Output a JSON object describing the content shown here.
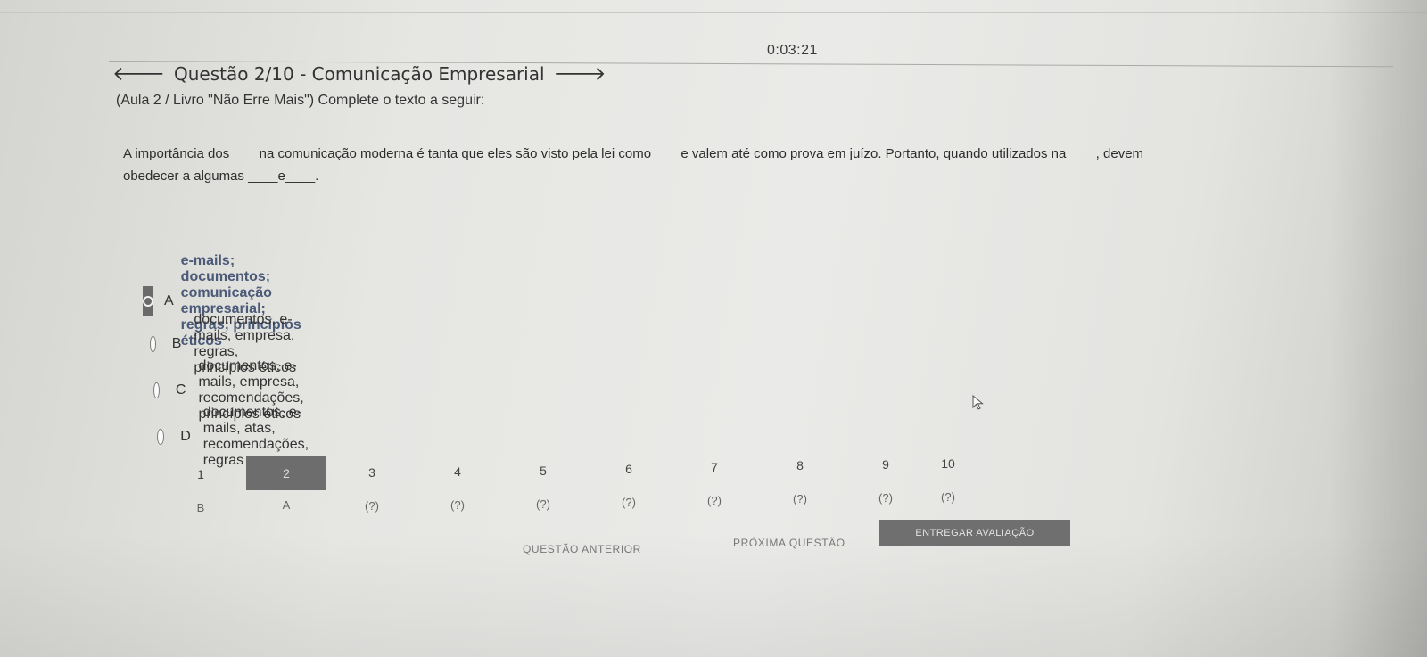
{
  "timer": "0:03:21",
  "header": {
    "title": "Questão 2/10 - Comunicação Empresarial",
    "subtitle": "(Aula 2 / Livro \"Não Erre Mais\") Complete o texto a seguir:"
  },
  "question": {
    "text_line1": "A importância dos____na comunicação moderna é tanta que eles são visto pela lei como____e valem até como prova em juízo. Portanto, quando utilizados na____, devem",
    "text_line2": "obedecer a algumas ____e____."
  },
  "options": [
    {
      "letter": "A",
      "text": "e-mails; documentos; comunicação empresarial; regras; princípios éticos",
      "selected": true
    },
    {
      "letter": "B",
      "text": "documentos, e-mails, empresa, regras, princípios éticos",
      "selected": false
    },
    {
      "letter": "C",
      "text": "documentos, e-mails, empresa, recomendações, princípios éticos",
      "selected": false
    },
    {
      "letter": "D",
      "text": "documentos, e-mails, atas, recomendações, regras",
      "selected": false
    }
  ],
  "navigator": {
    "numbers": [
      "1",
      "2",
      "3",
      "4",
      "5",
      "6",
      "7",
      "8",
      "9",
      "10"
    ],
    "answers": [
      "B",
      "A",
      "(?)",
      "(?)",
      "(?)",
      "(?)",
      "(?)",
      "(?)",
      "(?)",
      "(?)"
    ],
    "current": "2"
  },
  "buttons": {
    "previous": "QUESTÃO ANTERIOR",
    "next": "PRÓXIMA QUESTÃO",
    "submit": "ENTREGAR AVALIAÇÃO"
  },
  "colors": {
    "selected_option_text": "#4b5a77",
    "current_cell_bg": "#6d6d6d",
    "submit_bg": "#6f6f6f"
  }
}
